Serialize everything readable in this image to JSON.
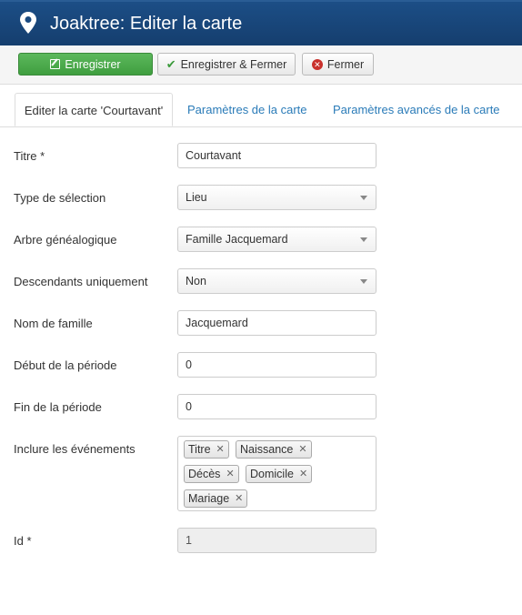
{
  "header": {
    "title": "Joaktree: Editer la carte",
    "icon": "map-marker-icon"
  },
  "toolbar": {
    "save_label": "Enregistrer",
    "save_close_label": "Enregistrer & Fermer",
    "close_label": "Fermer"
  },
  "tabs": [
    {
      "label": "Editer la carte 'Courtavant'"
    },
    {
      "label": "Paramètres de la carte"
    },
    {
      "label": "Paramètres avancés de la carte"
    }
  ],
  "form": {
    "titre": {
      "label": "Titre *",
      "value": "Courtavant"
    },
    "type_selection": {
      "label": "Type de sélection",
      "value": "Lieu"
    },
    "arbre": {
      "label": "Arbre généalogique",
      "value": "Famille Jacquemard"
    },
    "descendants": {
      "label": "Descendants uniquement",
      "value": "Non"
    },
    "nom_famille": {
      "label": "Nom de famille",
      "value": "Jacquemard"
    },
    "debut_periode": {
      "label": "Début de la période",
      "value": "0"
    },
    "fin_periode": {
      "label": "Fin de la période",
      "value": "0"
    },
    "evenements": {
      "label": "Inclure les événements",
      "chips": [
        "Titre",
        "Naissance",
        "Décès",
        "Domicile",
        "Mariage"
      ]
    },
    "id": {
      "label": "Id *",
      "value": "1"
    }
  },
  "colors": {
    "header_bg": "#1a4a80",
    "save_bg": "#4cae4c",
    "tab_link": "#2a7bb8"
  }
}
